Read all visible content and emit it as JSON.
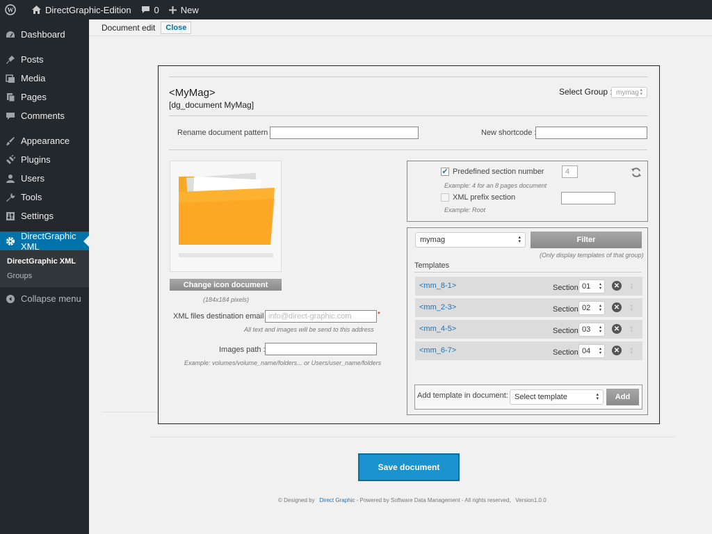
{
  "adminbar": {
    "site_name": "DirectGraphic-Edition",
    "comments_count": "0",
    "new_label": "New"
  },
  "sidebar": {
    "items": [
      {
        "label": "Dashboard",
        "icon": "dashboard-icon"
      },
      {
        "label": "Posts",
        "icon": "pin-icon"
      },
      {
        "label": "Media",
        "icon": "media-icon"
      },
      {
        "label": "Pages",
        "icon": "pages-icon"
      },
      {
        "label": "Comments",
        "icon": "comment-icon"
      },
      {
        "label": "Appearance",
        "icon": "brush-icon"
      },
      {
        "label": "Plugins",
        "icon": "plug-icon"
      },
      {
        "label": "Users",
        "icon": "user-icon"
      },
      {
        "label": "Tools",
        "icon": "wrench-icon"
      },
      {
        "label": "Settings",
        "icon": "settings-icon"
      },
      {
        "label": "DirectGraphic XML",
        "icon": "gear-icon"
      }
    ],
    "submenu": [
      "DirectGraphic XML",
      "Groups"
    ],
    "collapse_label": "Collapse menu"
  },
  "header": {
    "title": "Document edit",
    "close_label": "Close"
  },
  "doc": {
    "title": "<MyMag>",
    "shortcode": "[dg_document MyMag]",
    "select_group_label": "Select Group :",
    "select_group_value": "mymag",
    "rename_label": "Rename document pattern :",
    "rename_value": "",
    "shortcode_label": "New shortcode :",
    "shortcode_value": "",
    "change_icon_label": "Change icon document",
    "icon_size_note": "(184x184 pixels)",
    "email_label": "XML files destination email :",
    "email_placeholder": "info@direct-graphic.com",
    "email_note": "All text and images will be send to this address",
    "images_path_label": "Images path :",
    "images_path_value": "",
    "images_path_note": "Example: volumes/volume_name/folders... or Users/user_name/folders"
  },
  "options": {
    "predefined_label": "Predefined section number",
    "predefined_checked": true,
    "predefined_value": "4",
    "predefined_note": "Example: 4 for an 8 pages document",
    "xml_prefix_label": "XML prefix section",
    "xml_prefix_checked": false,
    "xml_prefix_value": "",
    "xml_prefix_note": "Example: Root"
  },
  "templates": {
    "filter_group": "mymag",
    "filter_label": "Filter",
    "filter_note": "(Only display templates of that group)",
    "heading": "Templates",
    "section_label": "Section",
    "rows": [
      {
        "name": "<mm_8-1>",
        "section": "01"
      },
      {
        "name": "<mm_2-3>",
        "section": "02"
      },
      {
        "name": "<mm_4-5>",
        "section": "03"
      },
      {
        "name": "<mm_6-7>",
        "section": "04"
      }
    ],
    "add_label": "Add template in document:",
    "add_select": "Select template",
    "add_button": "Add"
  },
  "save_label": "Save document",
  "footer": {
    "prefix": "© Designed by",
    "link": "Direct Graphic",
    "suffix": "- Powered by Software Data Management - All rights reserved,",
    "version": "Version1.0.0"
  },
  "colors": {
    "accent": "#0073aa",
    "save": "#1a93cf",
    "adminbar": "#23282d"
  }
}
